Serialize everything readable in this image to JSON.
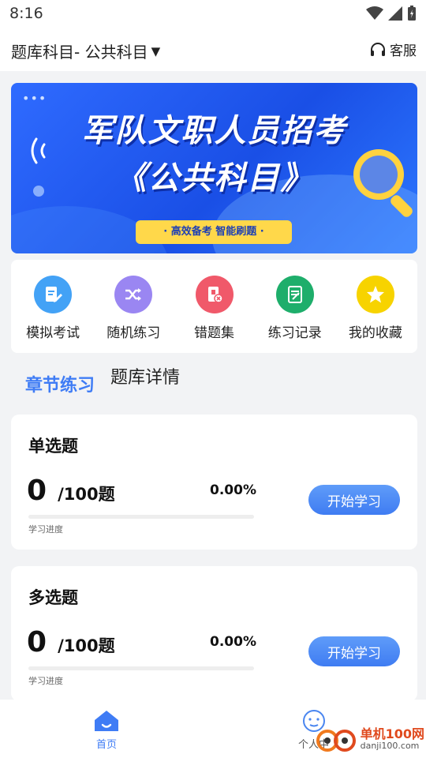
{
  "status_bar": {
    "time": "8:16"
  },
  "header": {
    "subject_label": "题库科目- 公共科目",
    "service_label": "客服"
  },
  "banner": {
    "line1": "军队文职人员招考",
    "line2": "《公共科目》",
    "tagline": "· 高效备考  智能刷题 ·"
  },
  "quick_actions": [
    {
      "label": "模拟考试",
      "icon": "exam-edit-icon",
      "color": "#43a2f6"
    },
    {
      "label": "随机练习",
      "icon": "shuffle-icon",
      "color": "#9a86f2"
    },
    {
      "label": "错题集",
      "icon": "wrong-questions-icon",
      "color": "#f0596a"
    },
    {
      "label": "练习记录",
      "icon": "record-icon",
      "color": "#1eae6b"
    },
    {
      "label": "我的收藏",
      "icon": "star-icon",
      "color": "#f7d300"
    }
  ],
  "tabs": {
    "active": "章节练习",
    "other": "题库详情"
  },
  "cards": [
    {
      "title": "单选题",
      "done": "0",
      "total": "/100题",
      "percent": "0.00%",
      "progress": 0,
      "progress_label": "学习进度",
      "button": "开始学习"
    },
    {
      "title": "多选题",
      "done": "0",
      "total": "/100题",
      "percent": "0.00%",
      "progress": 0,
      "progress_label": "学习进度",
      "button": "开始学习"
    }
  ],
  "bottom_nav": {
    "home": "首页",
    "profile": "个人中"
  },
  "watermark": {
    "main": "单机100网",
    "sub": "danji100.com"
  },
  "colors": {
    "accent": "#3f7cf5",
    "banner_blue": "#1a4fe6",
    "pill_yellow": "#ffd84a"
  }
}
